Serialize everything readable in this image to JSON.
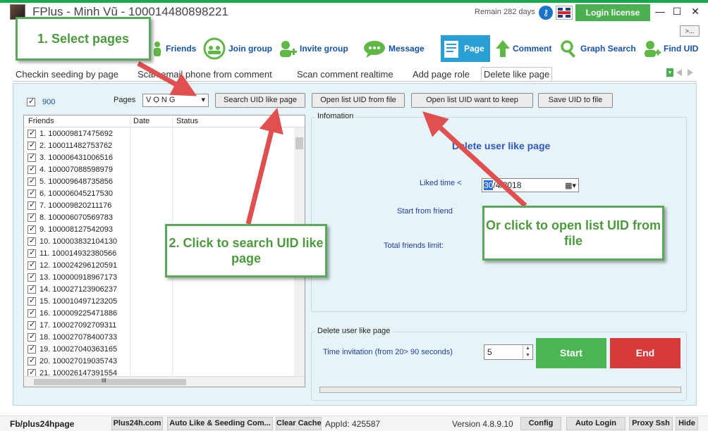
{
  "app": {
    "title": "FPlus - Minh Vũ - 100014480898221",
    "remain": "Remain 282 days",
    "login_label": "Login license",
    "minimize": "—",
    "maximize": "☐",
    "close": "✕",
    "expander": ">..."
  },
  "toolbar": {
    "items": [
      {
        "label": "Friends",
        "icon": "friends-icon"
      },
      {
        "label": "Join group",
        "icon": "join-group-icon"
      },
      {
        "label": "Invite group",
        "icon": "invite-group-icon"
      },
      {
        "label": "Message",
        "icon": "message-icon"
      },
      {
        "label": "Page",
        "icon": "page-icon"
      },
      {
        "label": "Comment",
        "icon": "comment-icon"
      },
      {
        "label": "Graph Search",
        "icon": "search-icon"
      },
      {
        "label": "Find UID",
        "icon": "find-uid-icon"
      }
    ],
    "active": "Page"
  },
  "subtabs": [
    "Checkin seeding by page",
    "Scan email phone from comment",
    "Scan comment realtime",
    "Add page role",
    "Delete like page"
  ],
  "controls": {
    "count": "900",
    "pages_label": "Pages",
    "pages_value": "VỌNG",
    "btn_search": "Search UID like page",
    "btn_open_list": "Open list UID from file",
    "btn_keep": "Open list UID want to keep",
    "btn_save": "Save UID to file"
  },
  "list": {
    "columns": [
      "Friends",
      "Date",
      "Status"
    ],
    "rows": [
      "1. 100009817475692",
      "2. 100011482753762",
      "3. 100006431006516",
      "4. 100007088598979",
      "5. 100009648735856",
      "6. 100006045217530",
      "7. 100009820211176",
      "8. 100006070569783",
      "9. 100008127542093",
      "10. 100003832104130",
      "11. 100014932380566",
      "12. 100024296120591",
      "13. 100000918967173",
      "14. 100027123906237",
      "15. 100010497123205",
      "16. 100009225471886",
      "17. 100027092709311",
      "18. 100027078400733",
      "19. 100027040363165",
      "20. 100027019035743",
      "21. 100026147391554"
    ],
    "hscroll_glyph": "III"
  },
  "info": {
    "group_label": "Infomation",
    "title": "Delete user like page",
    "liked_time_label": "Liked time <",
    "date_day": "30",
    "date_rest": "/4/2018",
    "start_from_label": "Start from friend",
    "total_limit_label": "Total friends limit:"
  },
  "delete_group": {
    "label": "Delete user like page",
    "time_label": "Time invitation (from 20> 90 seconds)",
    "time_value": "5",
    "start": "Start",
    "end": "End"
  },
  "callouts": {
    "step1": "1. Select pages",
    "step2": "2. Click to search UID like page",
    "or_open": "Or click to open list UID from file"
  },
  "statusbar": {
    "fb": "Fb/plus24hpage",
    "plus24": "Plus24h.com",
    "auto_like": "Auto Like & Seeding Com...",
    "clear_cache": "Clear Cache",
    "appid": "AppId: 425587",
    "version": "Version 4.8.9.10",
    "config": "Config",
    "auto_login": "Auto Login",
    "proxy": "Proxy Ssh",
    "hide": "Hide"
  },
  "colors": {
    "accent_green": "#17a84b",
    "active_tab": "#2a9fd6",
    "start": "#4cb654",
    "end": "#d63a3a",
    "arrow_red": "#e05050",
    "callout_border": "#5aa85a"
  }
}
